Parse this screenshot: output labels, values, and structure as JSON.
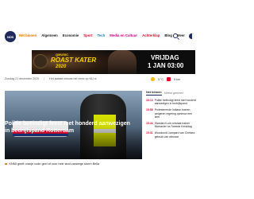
{
  "brand": {
    "logo_text": "NOS"
  },
  "nav": {
    "items": [
      {
        "label": "Net binnen",
        "class": "nav-active"
      },
      {
        "label": "Algemeen",
        "class": ""
      },
      {
        "label": "Economie",
        "class": ""
      },
      {
        "label": "Sport",
        "class": "nav-sport"
      },
      {
        "label": "Tech",
        "class": "nav-tech"
      },
      {
        "label": "Media en Cultuur",
        "class": "nav-media"
      },
      {
        "label": "Achterklap",
        "class": "nav-achter"
      },
      {
        "label": "Blog",
        "class": "nav-blog"
      },
      {
        "label": "Meer",
        "class": "nav-meer"
      }
    ],
    "search_icon": "search-icon",
    "theme_icon": "contrast-toggle-icon"
  },
  "banner": {
    "line1": "QMUSIC",
    "line2": "ROAST KATER",
    "line3": "2020",
    "date_line1": "VRIJDAG",
    "date_line2": "1 JAN 03:00"
  },
  "dateline": {
    "date": "Zondag 21 december 2020",
    "link": "Het laatste nieuws het eerst op NU.nl"
  },
  "weather": {
    "temp": "5 °C",
    "traffic": "5 km"
  },
  "hero": {
    "title": "Politie beëindigt feest met honderd aanwezigen in bedrijfspand Rotterdam"
  },
  "sub_item": {
    "text": "KNMI geeft oranje code geel af voor hele land vanwege storm Bella"
  },
  "right_column": {
    "tab_active": "Net binnen",
    "tab_other": "Meest gelezen",
    "items": [
      {
        "time": "16:13",
        "text": "Politie beëindigt feest met honderd aanwezigen in bedrijfspand"
      },
      {
        "time": "15:58",
        "text": "Protesterende Indiase boeren weigeren regering opnieuw een keer"
      },
      {
        "time": "15:44",
        "text": "Standard Luik ontslaat trainer Montanier na Tweede Kerstdag"
      },
      {
        "time": "15:31",
        "text": "Woodcock Liampard van Chelsea gebruik van winnaar"
      }
    ]
  },
  "colors": {
    "brand": "#1f2a5c",
    "accent": "#e17000",
    "sport": "#e5032d"
  }
}
